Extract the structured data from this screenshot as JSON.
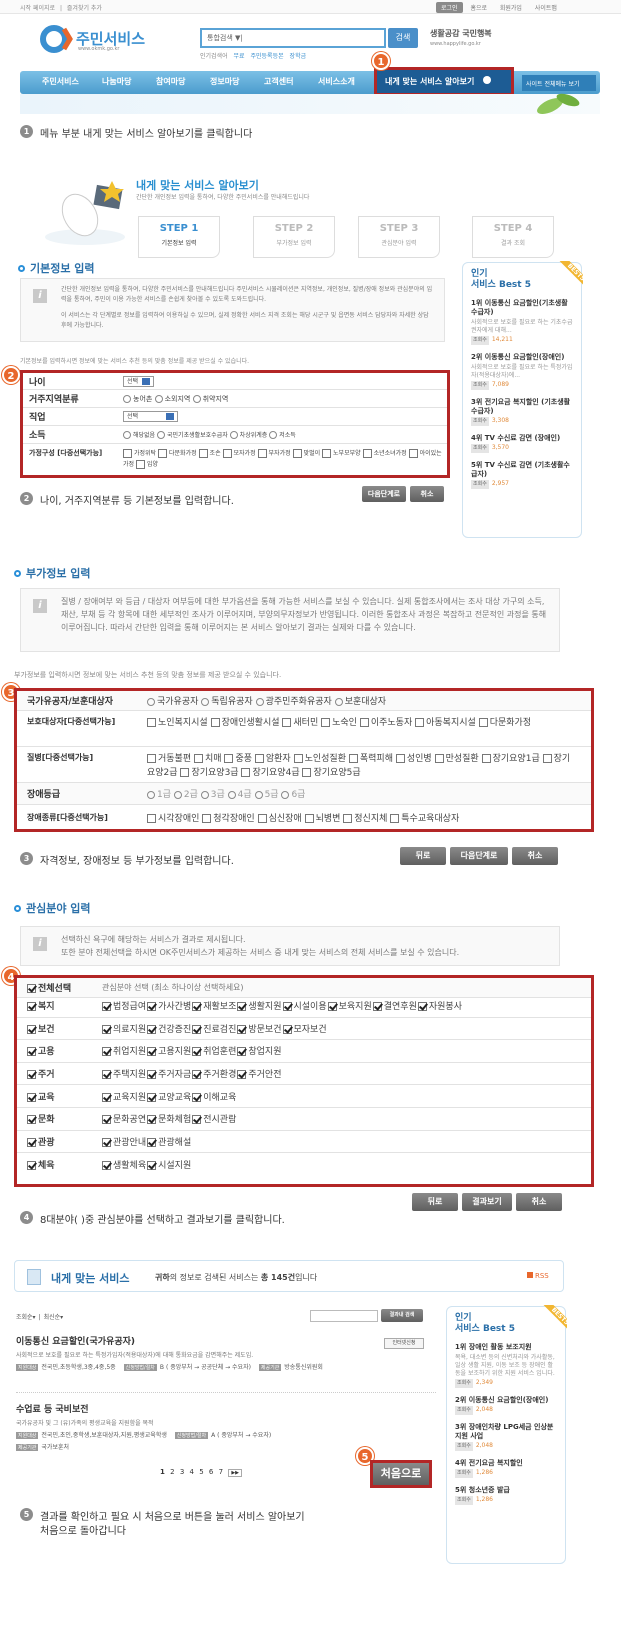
{
  "header": {
    "top_links": [
      "시작 페이지로",
      "즐겨찾기 추가"
    ],
    "top_right": [
      "로그인",
      "홈으로",
      "회원가입",
      "사이트맵"
    ],
    "logo_text": "주민서비스",
    "logo_url": "www.okmk.go.kr",
    "search_value": "통합검색  ▼|",
    "search_button": "검색",
    "popular_label": "인기검색어",
    "popular_terms": [
      "무료",
      "주민등록등본",
      "장학금"
    ],
    "slogan": "생활공감 국민행복",
    "slogan_url": "www.happylife.go.kr"
  },
  "nav": {
    "items": [
      "주민서비스",
      "나눔마당",
      "참여마당",
      "정보마당",
      "고객센터",
      "서비스소개"
    ],
    "highlight": "내게 맞는 서비스 알아보기",
    "sitemap": "사이트 전체메뉴 보기"
  },
  "steps_text": {
    "s1": "메뉴 부분 내게 맞는 서비스 알아보기를 클릭합니다",
    "s2": "나이, 거주지역분류 등 기본정보를 입력합니다.",
    "s3": "자격정보, 장애정보 등 부가정보를 입력합니다.",
    "s4": "8대분야( )중 관심분야를 선택하고 결과보기를 클릭합니다.",
    "s5a": "결과를 확인하고 필요 시 처음으로 버튼을 눌러 서비스 알아보기",
    "s5b": "처음으로 돌아갑니다"
  },
  "markers": [
    "1",
    "2",
    "3",
    "4",
    "5"
  ],
  "intro": {
    "title": "내게 맞는 서비스 알아보기",
    "subtitle": "간단한 개인정보 입력을 통하여, 다양한 주민서비스를 안내해드립니다",
    "steps": [
      {
        "num": "STEP 1",
        "name": "기본정보 입력"
      },
      {
        "num": "STEP 2",
        "name": "부가정보 입력"
      },
      {
        "num": "STEP 3",
        "name": "관심분야 입력"
      },
      {
        "num": "STEP 4",
        "name": "결과 조회"
      }
    ]
  },
  "basic": {
    "heading": "기본정보 입력",
    "info1": "간단한 개인정보 입력을 통하여, 다양한 주민서비스를 안내해드립니다 주민서비스 시뮬레이션은 지역정보, 개인정보, 질병/장애 정보와 관심분야의 입력을 통하여, 주민이 이용 가능한 서비스를 손쉽게 찾아볼 수 있도록 도와드립니다.",
    "info2": "이 서비스는 각 단계별로 정보를 입력하여 이용하실 수 있으며, 실제 정확한 서비스 지격 조회는 해당 시군구 및 읍면동 서비스 담당자와 자세한 상담 후에 가능합니다.",
    "note": "기본정보를 입력하시면 정보에 맞는 서비스 추천 등의 맞춤 정보를 제공 받으실 수 있습니다.",
    "rows": [
      {
        "label": "나이",
        "type": "select",
        "value": "선택"
      },
      {
        "label": "거주지역분류",
        "type": "radio",
        "options": [
          "농어촌",
          "소외지역",
          "취약지역"
        ]
      },
      {
        "label": "직업",
        "type": "select",
        "value": "선택"
      },
      {
        "label": "소득",
        "type": "radio",
        "options": [
          "해당없음",
          "국민기초생활보호수급자",
          "차상위계층",
          "저소득"
        ]
      },
      {
        "label": "가정구성 [다중선택가능]",
        "type": "check",
        "options": [
          "가정위탁",
          "다문화가정",
          "조손",
          "모자가정",
          "부자가정",
          "맞벌이",
          "노부모부양",
          "소년소녀가정",
          "아이있는가정",
          "입양"
        ]
      }
    ],
    "buttons": [
      "다음단계로",
      "취소"
    ]
  },
  "extra": {
    "heading": "부가정보 입력",
    "info": "질병 / 장애여부 와 등급 / 대상자 여부등에 대한 부가옵션을 통해 가능한 서비스를 보실 수 있습니다. 실제 통합조사에서는 조사 대상 가구의 소득, 재산, 부채 등 각 항목에 대한 세부적인 조사가 이루어지며, 부양의무자정보가 반영됩니다. 이러한 통합조사 과정은 복잡하고 전문적인 과정을 통해 이루어집니다. 따라서 간단한 입력을 통해 이루어지는 본 서비스 알아보기 결과는 실제와 다를 수 있습니다.",
    "note": "부가정보를 입력하시면 정보에 맞는 서비스 추천 등의 맞춤 정보를 제공 받으실 수 있습니다.",
    "rows": [
      {
        "label": "국가유공자/보훈대상자",
        "type": "radio",
        "options": [
          "국가유공자",
          "독립유공자",
          "광주민주화유공자",
          "보훈대상자"
        ]
      },
      {
        "label": "보호대상자[다중선택가능]",
        "type": "check",
        "options": [
          "노인복지시설",
          "장애인생활시설",
          "새터민",
          "노숙인",
          "이주노동자",
          "아동복지시설",
          "다문화가정"
        ]
      },
      {
        "label": "질병[다중선택가능]",
        "type": "check",
        "options": [
          "거동불편",
          "치매",
          "중풍",
          "암환자",
          "노인성질환",
          "폭력피해",
          "성인병",
          "만성질환",
          "장기요양1급",
          "장기요양2급",
          "장기요양3급",
          "장기요양4급",
          "장기요양5급"
        ]
      },
      {
        "label": "장애등급",
        "type": "radio",
        "options": [
          "1급",
          "2급",
          "3급",
          "4급",
          "5급",
          "6급"
        ]
      },
      {
        "label": "장애종류[다중선택가능]",
        "type": "check",
        "options": [
          "시각장애인",
          "청각장애인",
          "심신장애",
          "뇌병변",
          "정신지체",
          "특수교육대상자"
        ]
      }
    ],
    "buttons": [
      "뒤로",
      "다음단계로",
      "취소"
    ]
  },
  "interest": {
    "heading": "관심분야 입력",
    "info1": "선택하신 욕구에 해당하는 서비스가 결과로 제시됩니다.",
    "info2": "또한 분야 전체선택을 하시면 OK주민서비스가 제공하는 서비스 중 내게 맞는 서비스의 전체 서비스를 보실 수 있습니다.",
    "all_label": "전체선택",
    "all_hint": "관심분야 선택 (최소 하나이상 선택하세요)",
    "rows": [
      {
        "label": "복지",
        "options": [
          "법정급여",
          "가사간병",
          "재활보조",
          "생활지원",
          "시설이용",
          "보육지원",
          "결연후원",
          "자원봉사"
        ]
      },
      {
        "label": "보건",
        "options": [
          "의료지원",
          "건강증진",
          "진료검진",
          "방문보건",
          "모자보건"
        ]
      },
      {
        "label": "고용",
        "options": [
          "취업지원",
          "고용지원",
          "취업훈련",
          "창업지원"
        ]
      },
      {
        "label": "주거",
        "options": [
          "주택지원",
          "주거자금",
          "주거환경",
          "주거안전"
        ]
      },
      {
        "label": "교육",
        "options": [
          "교육지원",
          "교양교육",
          "이해교육"
        ]
      },
      {
        "label": "문화",
        "options": [
          "문화공연",
          "문화체험",
          "전시관람"
        ]
      },
      {
        "label": "관광",
        "options": [
          "관광안내",
          "관광해설"
        ]
      },
      {
        "label": "체육",
        "options": [
          "생활체육",
          "시설지원"
        ]
      }
    ],
    "buttons": [
      "뒤로",
      "결과보기",
      "취소"
    ]
  },
  "results": {
    "title": "내게 맞는 서비스",
    "summary_pre": "귀하",
    "summary_mid": "의 정보로 검색된 서비스는 ",
    "summary_count": "총 145건",
    "summary_post": "입니다",
    "rss": "RSS",
    "sort1": "조회순▾",
    "sort2": "최신순▾",
    "search_in_results": "결과내 검색",
    "items": [
      {
        "title": "이동통신 요금할인(국가유공자)",
        "desc": "사회적으로 보호를 필요로 하는 특정가입자(적용대상자)에 대해 통화요금을 감면해주는 제도임.",
        "tag1": "지원대상",
        "target": "전국민,초등학생,3중,4중,5중",
        "tag2": "신청방법/절차",
        "method": "B ( 중앙부처 → 공공단체 → 수요자)",
        "tag3": "제공기관",
        "org": "방송통신위원회",
        "action": "인터넷신청"
      },
      {
        "title": "수업료 등 국비보전",
        "desc": "국가유공자 및 그 (유)가족의 평생교육을 지원함을 목적",
        "tag1": "지원대상",
        "target": "전국민,초인,중학생,보훈대상자,지원,평생교육학생",
        "tag2": "신청방법/절차",
        "method": "A ( 중앙부처 → 수요자)",
        "tag3": "제공기관",
        "org": "국가보훈처"
      }
    ],
    "pages": [
      "1",
      "2",
      "3",
      "4",
      "5",
      "6",
      "7"
    ],
    "next": "▶▶",
    "home_button": "처음으로"
  },
  "best1": {
    "title1": "인기",
    "title2": "서비스 Best 5",
    "ribbon": "BEST5",
    "items": [
      {
        "rank": "1위 이동통신 요금할인(기초생활수급자)",
        "desc": "사회적으로 보호를 필요로 하는 기초수급권자에게 대해...",
        "count": "14,211"
      },
      {
        "rank": "2위 이동통신 요금할인(장애인)",
        "desc": "사회적으로 보호를 필요로 하는 특정가입자(적용대상자)에...",
        "count": "7,089"
      },
      {
        "rank": "3위 전기요금 복지할인 (기초생활수급자)",
        "desc": "",
        "count": "3,308"
      },
      {
        "rank": "4위 TV 수신료 감면 (장애인)",
        "desc": "",
        "count": "3,570"
      },
      {
        "rank": "5위 TV 수신료 감면 (기초생활수급자)",
        "desc": "",
        "count": "2,957"
      }
    ]
  },
  "best2": {
    "title1": "인기",
    "title2": "서비스 Best 5",
    "ribbon": "BEST5",
    "items": [
      {
        "rank": "1위 장애인 활동 보조지원",
        "desc": "목욕, 대소변 등의 신변처리와 가사활동, 일상 생활 지원, 이동 보조 등 장애인 활동을 보조하기 위한 지원 서비스 입니다.",
        "count": "2,349"
      },
      {
        "rank": "2위 이동통신 요금할인(장애인)",
        "desc": "",
        "count": "2,048"
      },
      {
        "rank": "3위 장애인차량 LPG세금 인상분 지원 사업",
        "desc": "",
        "count": "2,048"
      },
      {
        "rank": "4위 전기요금 복지할인",
        "desc": "",
        "count": "1,286"
      },
      {
        "rank": "5위 청소년증 발급",
        "desc": "",
        "count": "1,286"
      }
    ]
  }
}
